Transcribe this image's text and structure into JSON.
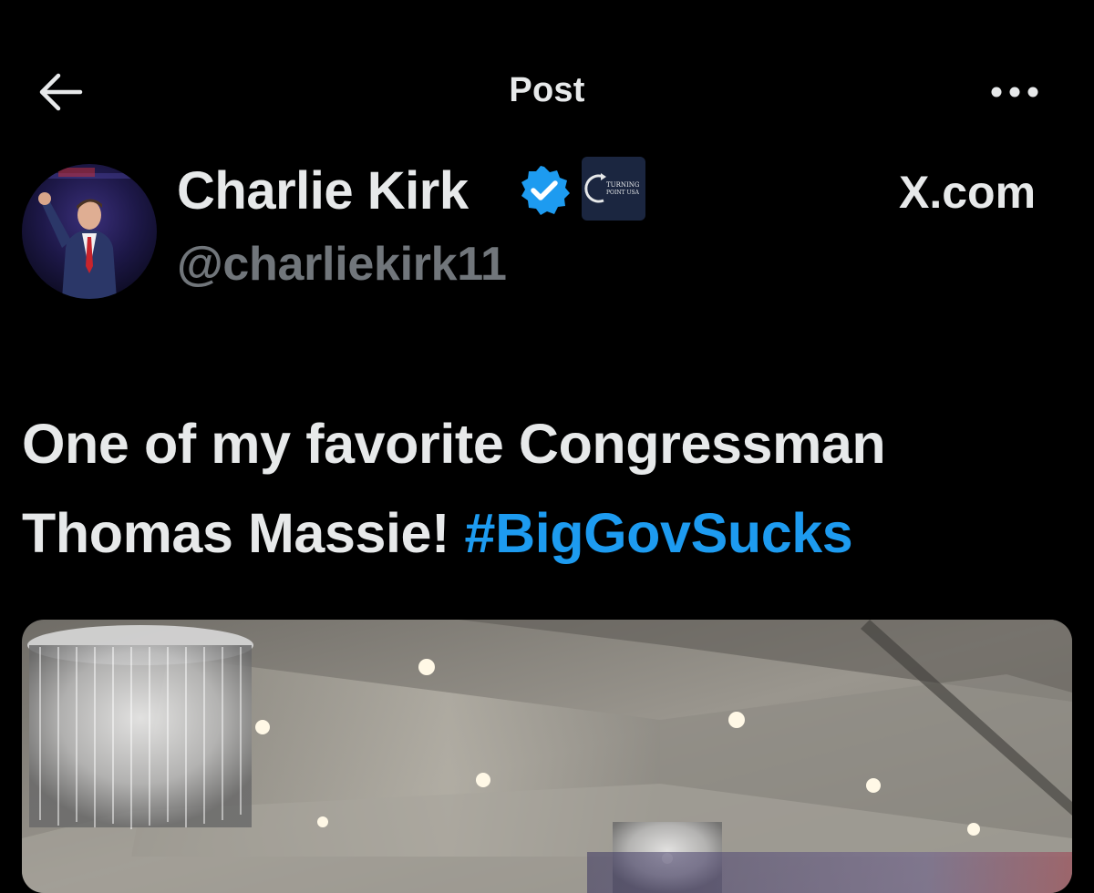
{
  "header": {
    "title": "Post",
    "back_icon": "arrow-left-icon",
    "more_icon": "more-horizontal-icon"
  },
  "author": {
    "name": "Charlie Kirk",
    "handle": "@charliekirk11",
    "verified_icon": "verified-badge-icon",
    "verified_color": "#1d9bf0",
    "affiliate": "TURNING POINT USA"
  },
  "source": "X.com",
  "post": {
    "text": "One of my favorite Congressman Thomas Massie! ",
    "hashtag": "#BigGovSucks",
    "hashtag_color": "#1d9bf0"
  },
  "media": {
    "type": "photo"
  }
}
